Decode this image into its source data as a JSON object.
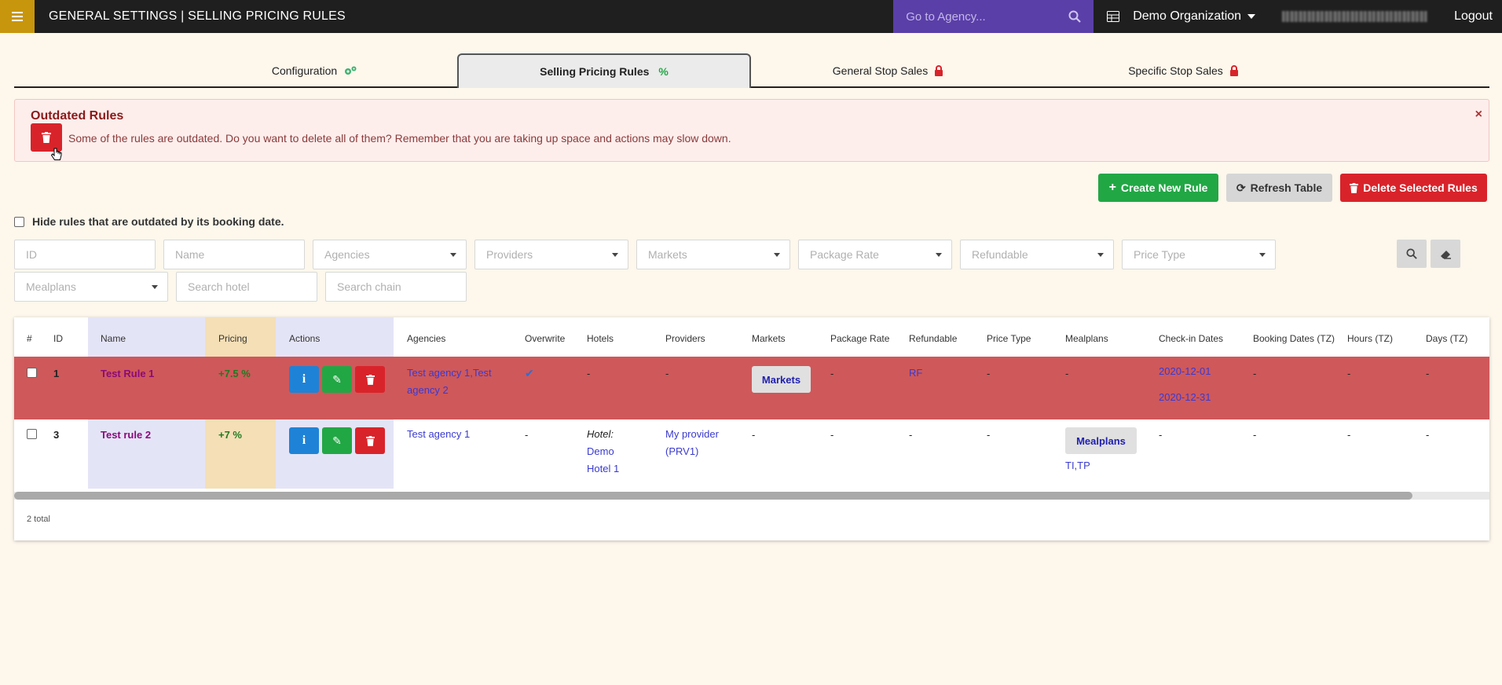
{
  "topbar": {
    "title": "GENERAL SETTINGS | SELLING PRICING RULES",
    "agency_search_placeholder": "Go to Agency...",
    "organization": "Demo Organization",
    "logout": "Logout"
  },
  "tabs": [
    {
      "label": "Configuration",
      "icon": "cogs-icon"
    },
    {
      "label": "Selling Pricing Rules",
      "icon": "percent-icon",
      "active": true
    },
    {
      "label": "General Stop Sales",
      "icon": "lock-icon"
    },
    {
      "label": "Specific Stop Sales",
      "icon": "lock-icon"
    }
  ],
  "alert": {
    "title": "Outdated Rules",
    "text": "Some of the rules are outdated. Do you want to delete all of them? Remember that you are taking up space and actions may slow down.",
    "close": "×"
  },
  "actions": {
    "create": "Create New Rule",
    "refresh": "Refresh Table",
    "delete_selected": "Delete Selected Rules"
  },
  "filters": {
    "hide_outdated_label": "Hide rules that are outdated by its booking date.",
    "id": "ID",
    "name": "Name",
    "agencies": "Agencies",
    "providers": "Providers",
    "markets": "Markets",
    "package_rate": "Package Rate",
    "refundable": "Refundable",
    "price_type": "Price Type",
    "mealplans": "Mealplans",
    "search_hotel": "Search hotel",
    "search_chain": "Search chain"
  },
  "table": {
    "headers": [
      "#",
      "ID",
      "Name",
      "Pricing",
      "Actions",
      "Agencies",
      "Overwrite",
      "Hotels",
      "Providers",
      "Markets",
      "Package Rate",
      "Refundable",
      "Price Type",
      "Mealplans",
      "Check-in Dates",
      "Booking Dates (TZ)",
      "Hours (TZ)",
      "Days (TZ)"
    ],
    "rows": [
      {
        "id": "1",
        "name": "Test Rule 1",
        "pricing": "+7.5 %",
        "agencies": "Test agency 1,Test agency 2",
        "overwrite": "✔",
        "hotels": "-",
        "providers": "-",
        "markets": "Markets",
        "package_rate": "-",
        "refundable": "RF",
        "price_type": "-",
        "mealplans": "-",
        "checkin_from": "2020-12-01",
        "checkin_to": "2020-12-31",
        "booking_dates": "-",
        "hours": "-",
        "days": "-"
      },
      {
        "id": "3",
        "name": "Test rule 2",
        "pricing": "+7 %",
        "agencies": "Test agency 1",
        "overwrite": "-",
        "hotels_label": "Hotel:",
        "hotels_value": "Demo Hotel 1",
        "providers": "My provider (PRV1)",
        "markets": "-",
        "package_rate": "-",
        "refundable": "-",
        "price_type": "-",
        "mealplans": "Mealplans",
        "mealplans_values": "TI,TP",
        "checkin": "-",
        "booking_dates": "-",
        "hours": "-",
        "days": "-"
      }
    ],
    "total": "2 total"
  },
  "colors": {
    "topbar": "#1f1f1f",
    "menu": "#c8960c",
    "agency_search": "#5a3fa8",
    "outdated_row": "#cf585a",
    "name_col": "#e4e4f7",
    "pricing_col": "#f4dfb6",
    "actions_col": "#e4e4f7"
  }
}
